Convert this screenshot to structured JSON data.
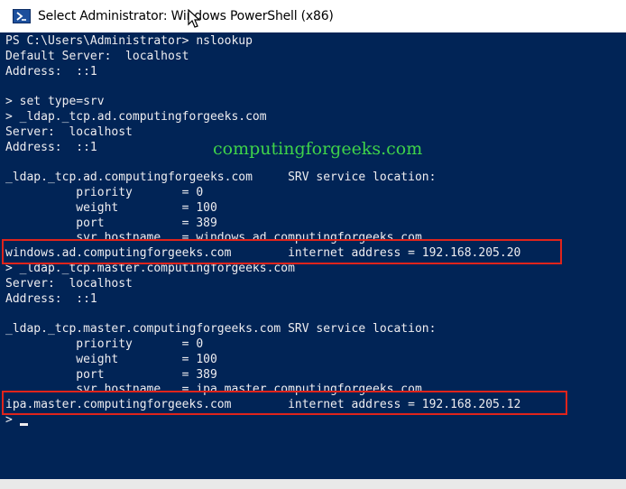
{
  "window": {
    "title": "Select Administrator: Windows PowerShell (x86)",
    "icon": "powershell-icon"
  },
  "colors": {
    "console_bg": "#012456",
    "console_text": "#eeedf0",
    "watermark": "#3fd34a",
    "highlight": "#e0241b"
  },
  "watermark": "computingforgeeks.com",
  "console": {
    "lines": [
      "PS C:\\Users\\Administrator> nslookup",
      "Default Server:  localhost",
      "Address:  ::1",
      "",
      "> set type=srv",
      "> _ldap._tcp.ad.computingforgeeks.com",
      "Server:  localhost",
      "Address:  ::1",
      "",
      "_ldap._tcp.ad.computingforgeeks.com     SRV service location:",
      "          priority       = 0",
      "          weight         = 100",
      "          port           = 389",
      "          svr hostname   = windows.ad.computingforgeeks.com",
      "windows.ad.computingforgeeks.com        internet address = 192.168.205.20",
      "> _ldap._tcp.master.computingforgeeks.com",
      "Server:  localhost",
      "Address:  ::1",
      "",
      "_ldap._tcp.master.computingforgeeks.com SRV service location:",
      "          priority       = 0",
      "          weight         = 100",
      "          port           = 389",
      "          svr hostname   = ipa.master.computingforgeeks.com",
      "ipa.master.computingforgeeks.com        internet address = 192.168.205.12",
      ">"
    ]
  }
}
